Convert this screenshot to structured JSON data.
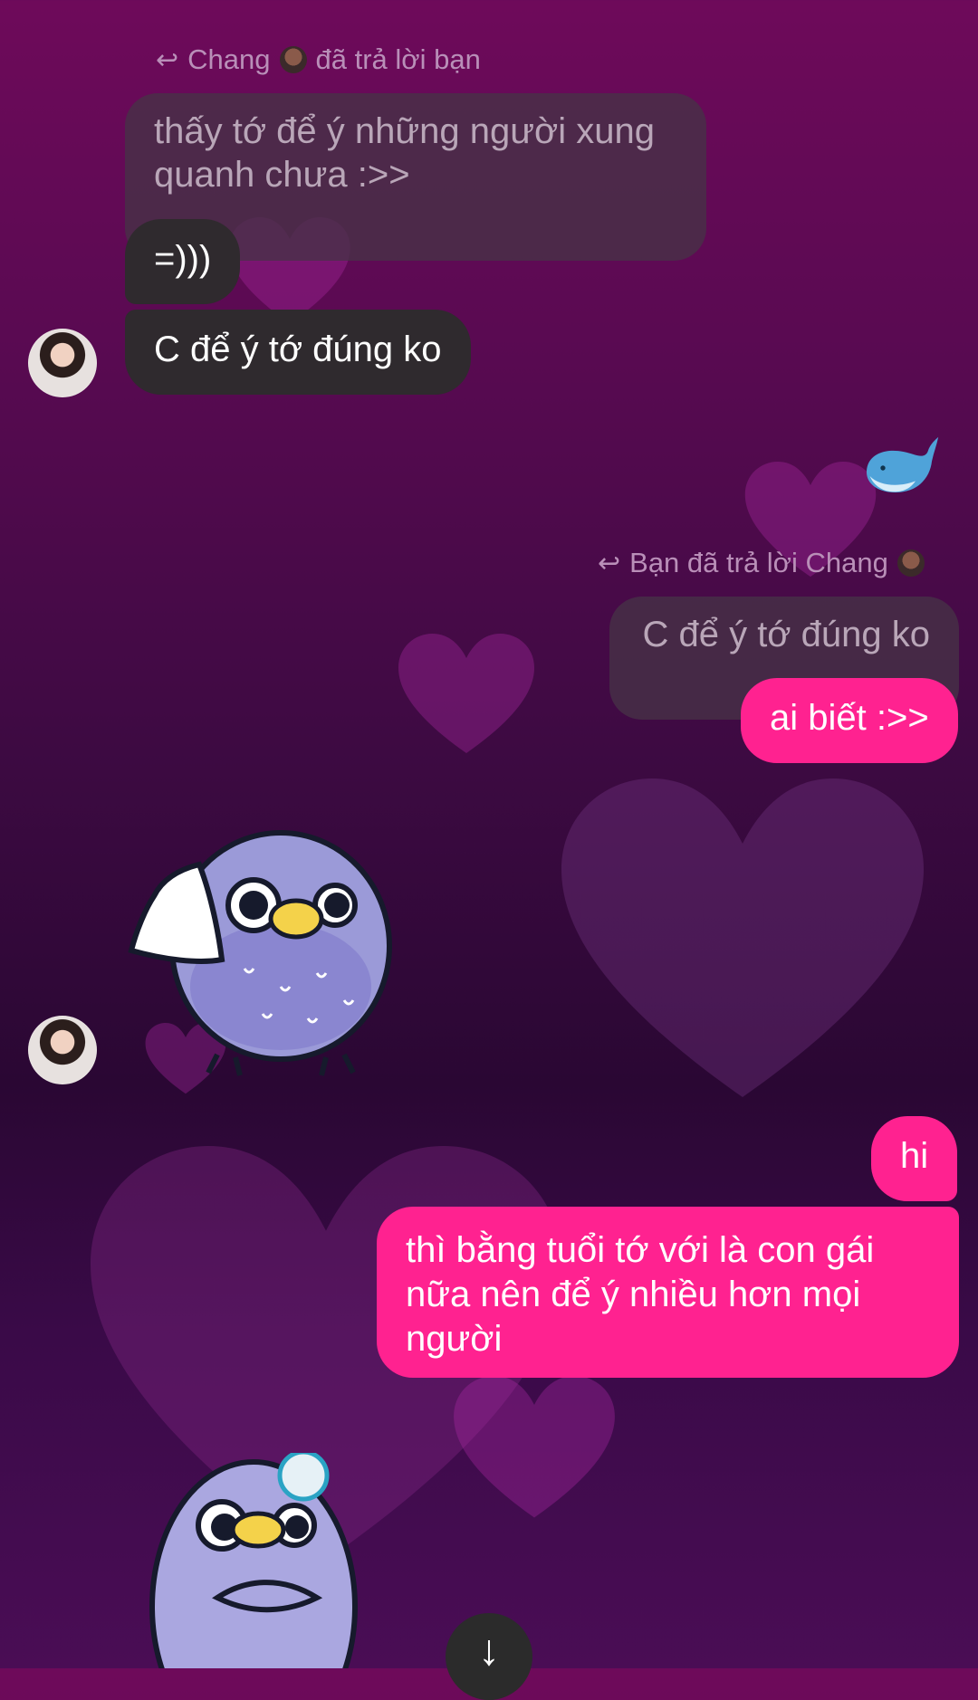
{
  "messages": {
    "reply1": {
      "meta_prefix": "Chang",
      "meta_suffix": "đã trả lời bạn",
      "quoted_text": "thấy tớ để ý những người xung quanh chưa :>>"
    },
    "in1": {
      "text": "=)))"
    },
    "in2": {
      "text": "C để ý tớ đúng ko"
    },
    "out_emoji": {
      "label": "whale-emoji",
      "glyph": "🐋"
    },
    "reply2": {
      "meta_prefix": "Bạn đã trả lời Chang",
      "quoted_text": "C để ý tớ đúng ko"
    },
    "out1": {
      "text": "ai biết :>>"
    },
    "sticker1": {
      "label": "bird-sticker-towel"
    },
    "out2": {
      "text": "hi"
    },
    "out3": {
      "text": "thì bằng tuổi tớ với là con gái nữa nên để ý nhiều hơn mọi người"
    },
    "sticker2": {
      "label": "bird-sticker-sweat"
    }
  },
  "scroll_down": {
    "icon": "arrow-down-icon",
    "glyph": "↓"
  },
  "colors": {
    "outgoing_bubble": "#ff2290",
    "incoming_bubble": "#2f2a2e",
    "quoted_bubble": "#46324a"
  }
}
